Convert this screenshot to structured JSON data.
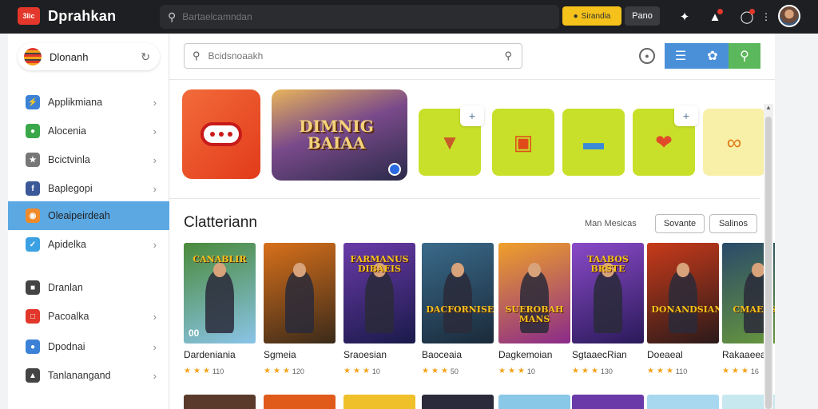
{
  "app": {
    "logo_text": "3lic",
    "title": "Dprahkan"
  },
  "topbar": {
    "search_placeholder": "Bartaelcamndan",
    "yellow_button_label": "Sirandia",
    "dark_button_label": "Pano",
    "icons": [
      "puzzle-icon",
      "bell-icon",
      "notification-icon",
      "more-icon"
    ]
  },
  "sidebar": {
    "header_label": "Dlonanh",
    "items": [
      {
        "label": "Applikmiana",
        "icon": "bolt-icon",
        "color": "#3b82d6",
        "chevron": true,
        "active": false
      },
      {
        "label": "Alocenia",
        "icon": "chat-icon",
        "color": "#3aa84a",
        "chevron": true,
        "active": false
      },
      {
        "label": "Bcictvinla",
        "icon": "star-icon",
        "color": "#777777",
        "chevron": true,
        "active": false
      },
      {
        "label": "Baplegopi",
        "icon": "facebook-icon",
        "color": "#3b5998",
        "chevron": true,
        "active": false
      },
      {
        "label": "Oleaipeirdeah",
        "icon": "badge-icon",
        "color": "#f08a2a",
        "chevron": false,
        "active": true
      },
      {
        "label": "Apidelka",
        "icon": "twitter-icon",
        "color": "#3ba1e3",
        "chevron": true,
        "active": false
      },
      {
        "label": "Dranlan",
        "icon": "calendar-icon",
        "color": "#444444",
        "chevron": false,
        "active": false
      },
      {
        "label": "Pacoalka",
        "icon": "doc-icon",
        "color": "#e2372a",
        "chevron": true,
        "active": false
      },
      {
        "label": "Dpodnai",
        "icon": "chat-bubble-icon",
        "color": "#3b82d6",
        "chevron": true,
        "active": false
      },
      {
        "label": "Tanlanangand",
        "icon": "bag-icon",
        "color": "#444444",
        "chevron": true,
        "active": false
      }
    ]
  },
  "main": {
    "search_placeholder": "Bcidsnoaakh",
    "featured_banner_title": "DIMNIG BAIAA",
    "section_title": "Clatteriann",
    "sort_label": "Man Mesicas",
    "filter_buttons": [
      "Sovante",
      "Salinos"
    ],
    "view_buttons": [
      {
        "icon": "list-icon",
        "color": "#4a90d9"
      },
      {
        "icon": "grid-icon",
        "color": "#4a90d9"
      },
      {
        "icon": "search-icon",
        "color": "#5cb85c"
      }
    ]
  },
  "games": [
    {
      "name": "Dardeniania",
      "rating": "110",
      "logo": "CANABLIR",
      "art": [
        "#4a8a3a",
        "#8ac4e8"
      ],
      "badge": "00"
    },
    {
      "name": "Sgmeia",
      "rating": "120",
      "logo": "",
      "art": [
        "#d8701a",
        "#3a2a1a"
      ],
      "badge": ""
    },
    {
      "name": "Sraoesian",
      "rating": "10",
      "logo": "FARMANUS DIBAEIS",
      "art": [
        "#6a3aa8",
        "#1a1a4a"
      ],
      "badge": ""
    },
    {
      "name": "Baoceaia",
      "rating": "50",
      "logo": "DACFORNISE",
      "art": [
        "#3a6a8a",
        "#1a2a3a"
      ],
      "badge": ""
    },
    {
      "name": "Dagkemoian",
      "rating": "10",
      "logo": "SUEROBAH MANS",
      "art": [
        "#f0a02a",
        "#8a2a8a"
      ],
      "badge": ""
    },
    {
      "name": "SgtaaecRian",
      "rating": "130",
      "logo": "TAABOS BRSTE",
      "art": [
        "#8a4ac8",
        "#2a1a5a"
      ],
      "badge": ""
    },
    {
      "name": "Doeaeal",
      "rating": "110",
      "logo": "DONANDSIAN",
      "art": [
        "#c83a1a",
        "#2a1a1a"
      ],
      "badge": ""
    },
    {
      "name": "Rakaaeea",
      "rating": "16",
      "logo": "CMAEASA",
      "art": [
        "#2a4a6a",
        "#6a9a3a"
      ],
      "badge": ""
    }
  ],
  "featured_tile_colors": [
    "#c8e02a",
    "#c8e02a",
    "#c8e02a",
    "#c8e02a",
    "#f8f0a8"
  ],
  "next_row_colors": [
    "#5a3a2a",
    "#e05a1a",
    "#f0c02a",
    "#2a2a3a",
    "#8ac8e8",
    "#6a3aa8",
    "#a8d8f0",
    "#c8e8f0"
  ]
}
